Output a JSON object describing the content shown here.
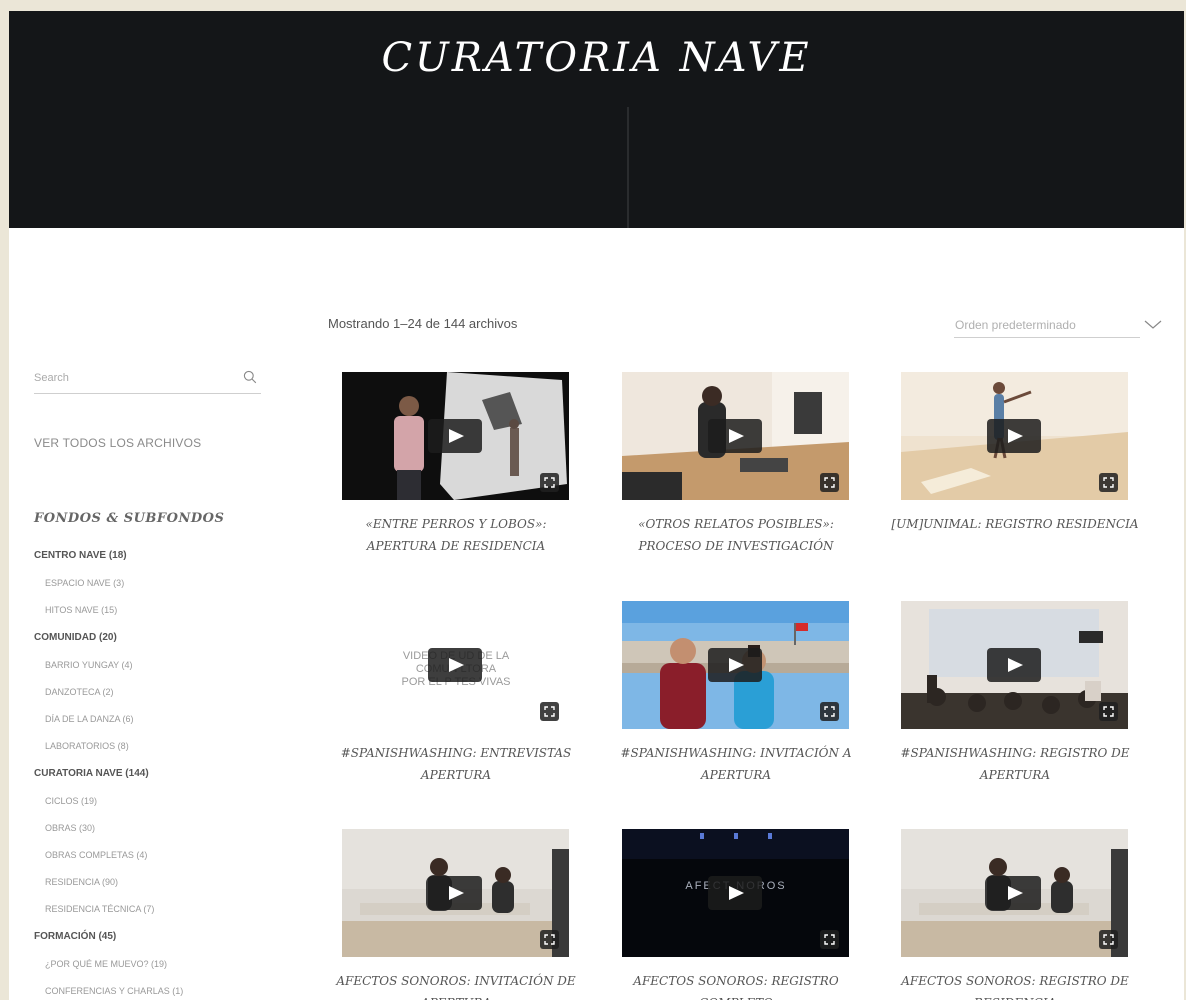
{
  "site": {
    "title": "CURATORIA NAVE"
  },
  "toolbar": {
    "result_count": "Mostrando 1–24 de 144 archivos",
    "orderby_selected": "Orden predeterminado"
  },
  "sidebar": {
    "search_placeholder": "Search",
    "view_all": "VER TODOS LOS ARCHIVOS",
    "fondos_heading": "FONDOS & SUBFONDOS",
    "categories": [
      {
        "label": "CENTRO NAVE (18)",
        "level": "parent"
      },
      {
        "label": "ESPACIO NAVE (3)",
        "level": "child"
      },
      {
        "label": "HITOS NAVE (15)",
        "level": "child"
      },
      {
        "label": "COMUNIDAD (20)",
        "level": "parent"
      },
      {
        "label": "BARRIO YUNGAY (4)",
        "level": "child"
      },
      {
        "label": "DANZOTECA (2)",
        "level": "child"
      },
      {
        "label": "DÍA DE LA DANZA (6)",
        "level": "child"
      },
      {
        "label": "LABORATORIOS (8)",
        "level": "child"
      },
      {
        "label": "CURATORIA NAVE (144)",
        "level": "parent"
      },
      {
        "label": "CICLOS (19)",
        "level": "child"
      },
      {
        "label": "OBRAS (30)",
        "level": "child"
      },
      {
        "label": "OBRAS COMPLETAS (4)",
        "level": "child"
      },
      {
        "label": "RESIDENCIA (90)",
        "level": "child"
      },
      {
        "label": "RESIDENCIA TÉCNICA (7)",
        "level": "child"
      },
      {
        "label": "FORMACIÓN (45)",
        "level": "parent"
      },
      {
        "label": "¿POR QUÉ ME MUEVO? (19)",
        "level": "child"
      },
      {
        "label": "CONFERENCIAS Y CHARLAS (1)",
        "level": "child"
      }
    ]
  },
  "products": [
    {
      "title": "«ENTRE PERROS Y LOBOS»: APERTURA DE RESIDENCIA"
    },
    {
      "title": "«OTROS RELATOS POSIBLES»: PROCESO DE INVESTIGACIÓN"
    },
    {
      "title": "[UM]UNIMAL: REGISTRO RESIDENCIA"
    },
    {
      "title": "#SPANISHWASHING: ENTREVISTAS APERTURA",
      "thumb_text_1": "VIDEO DE    UD DE LA",
      "thumb_text_2": "COMUN      LTORA",
      "thumb_text_3": "POR EL P      TES VIVAS"
    },
    {
      "title": "#SPANISHWASHING: INVITACIÓN A APERTURA"
    },
    {
      "title": "#SPANISHWASHING: REGISTRO DE APERTURA"
    },
    {
      "title": "AFECTOS SONOROS: INVITACIÓN DE APERTURA"
    },
    {
      "title": "AFECTOS SONOROS: REGISTRO COMPLETO",
      "thumb_text_1": "AFECT       NOROS"
    },
    {
      "title": "AFECTOS SONOROS: REGISTRO DE RESIDENCIA"
    }
  ],
  "colors": {
    "frame": "#ebe6d7",
    "hero": "#141618",
    "text": "#555555",
    "muted": "#999999"
  }
}
